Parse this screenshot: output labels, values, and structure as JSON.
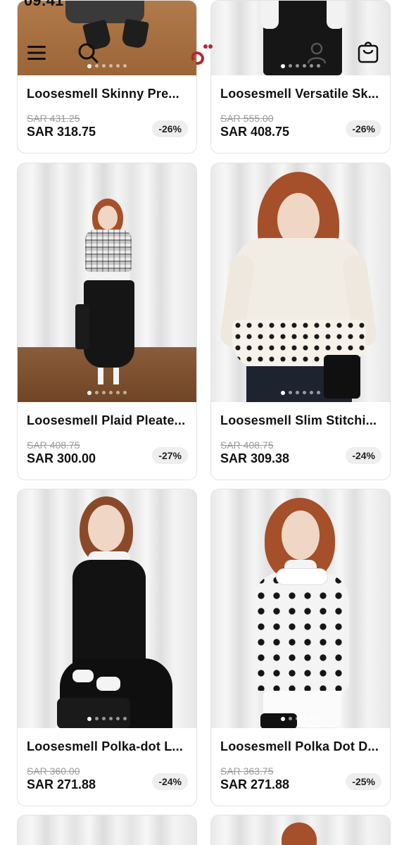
{
  "status_bar": {
    "time": "09:41"
  },
  "header": {
    "menu_icon": "hamburger-menu-icon",
    "search_icon": "search-icon",
    "logo_glyph": "ق",
    "account_icon": "user-icon",
    "bag_icon": "shopping-bag-icon",
    "logo_color": "#b5262f"
  },
  "products": [
    {
      "title": "Loosesmell Skinny Pre...",
      "old_price": "SAR 431.25",
      "price": "SAR 318.75",
      "discount": "-26%"
    },
    {
      "title": "Loosesmell Versatile Sk...",
      "old_price": "SAR 555.00",
      "price": "SAR 408.75",
      "discount": "-26%"
    },
    {
      "title": "Loosesmell Plaid Pleate...",
      "old_price": "SAR 408.75",
      "price": "SAR 300.00",
      "discount": "-27%"
    },
    {
      "title": "Loosesmell Slim Stitchi...",
      "old_price": "SAR 408.75",
      "price": "SAR 309.38",
      "discount": "-24%"
    },
    {
      "title": "Loosesmell Polka-dot L...",
      "old_price": "SAR 360.00",
      "price": "SAR 271.88",
      "discount": "-24%"
    },
    {
      "title": "Loosesmell Polka Dot D...",
      "old_price": "SAR 363.75",
      "price": "SAR 271.88",
      "discount": "-25%"
    }
  ]
}
